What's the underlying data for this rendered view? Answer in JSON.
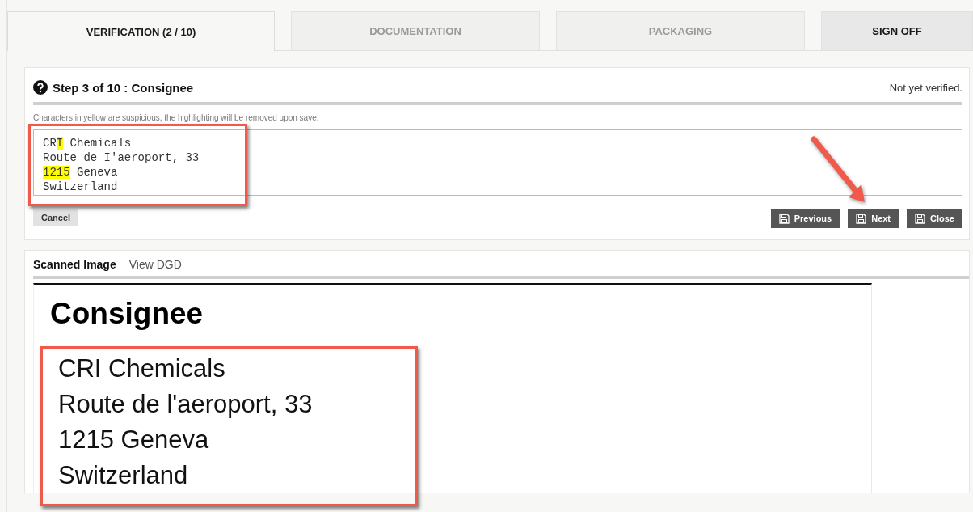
{
  "tabs": [
    {
      "label": "VERIFICATION (2 / 10)",
      "selected": true,
      "disabled": false
    },
    {
      "label": "DOCUMENTATION",
      "selected": false,
      "disabled": true
    },
    {
      "label": "PACKAGING",
      "selected": false,
      "disabled": true
    },
    {
      "label": "SIGN OFF",
      "selected": false,
      "disabled": false
    }
  ],
  "step": {
    "title": "Step 3 of 10 : Consignee",
    "status": "Not yet verified.",
    "hint": "Characters in yellow are suspicious, the highlighting will be removed upon save.",
    "address_lines": [
      [
        {
          "text": "CR",
          "suspicious": false
        },
        {
          "text": "I",
          "suspicious": true
        },
        {
          "text": " Chemicals",
          "suspicious": false
        }
      ],
      [
        {
          "text": "Route de I'aeroport, 33",
          "suspicious": false
        }
      ],
      [
        {
          "text": "1215",
          "suspicious": true
        },
        {
          "text": " Geneva",
          "suspicious": false
        }
      ],
      [
        {
          "text": "Switzerland",
          "suspicious": false
        }
      ]
    ],
    "cancel": "Cancel",
    "buttons": [
      "Previous",
      "Next",
      "Close"
    ]
  },
  "viewer": {
    "tabs": [
      {
        "label": "Scanned Image",
        "selected": true
      },
      {
        "label": "View DGD",
        "selected": false
      }
    ],
    "document": {
      "heading": "Consignee",
      "lines": [
        "CRI Chemicals",
        "Route de l'aeroport, 33",
        "1215 Geneva",
        "Switzerland"
      ]
    }
  }
}
